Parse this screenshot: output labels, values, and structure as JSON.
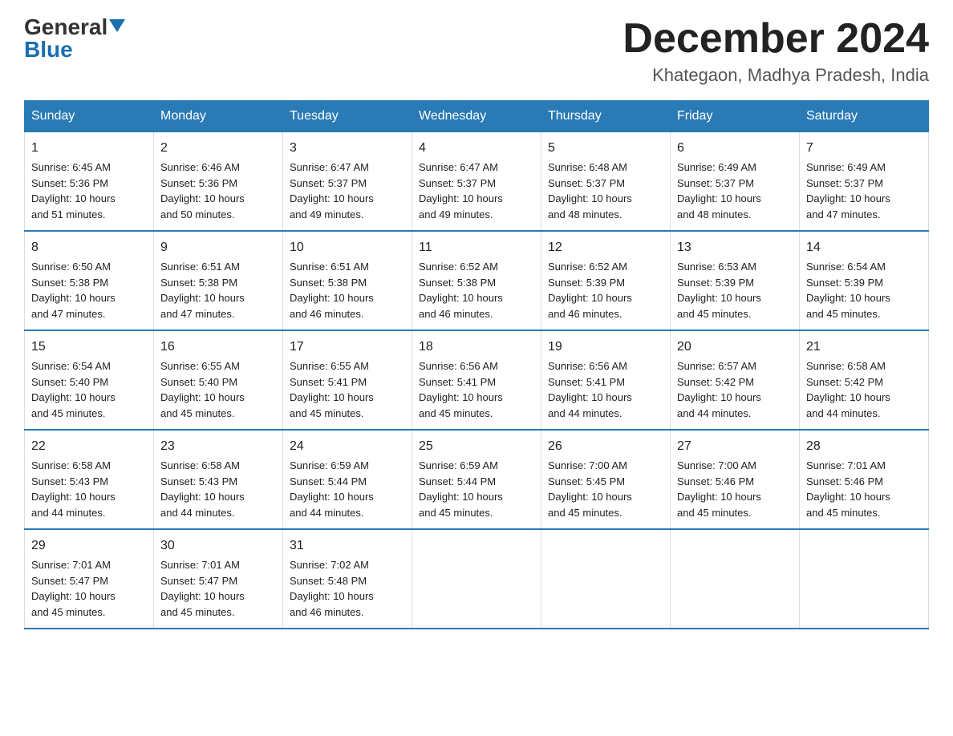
{
  "header": {
    "logo_general": "General",
    "logo_blue": "Blue",
    "month_title": "December 2024",
    "location": "Khategaon, Madhya Pradesh, India"
  },
  "days_of_week": [
    "Sunday",
    "Monday",
    "Tuesday",
    "Wednesday",
    "Thursday",
    "Friday",
    "Saturday"
  ],
  "weeks": [
    [
      {
        "day": "1",
        "sunrise": "6:45 AM",
        "sunset": "5:36 PM",
        "daylight": "10 hours and 51 minutes."
      },
      {
        "day": "2",
        "sunrise": "6:46 AM",
        "sunset": "5:36 PM",
        "daylight": "10 hours and 50 minutes."
      },
      {
        "day": "3",
        "sunrise": "6:47 AM",
        "sunset": "5:37 PM",
        "daylight": "10 hours and 49 minutes."
      },
      {
        "day": "4",
        "sunrise": "6:47 AM",
        "sunset": "5:37 PM",
        "daylight": "10 hours and 49 minutes."
      },
      {
        "day": "5",
        "sunrise": "6:48 AM",
        "sunset": "5:37 PM",
        "daylight": "10 hours and 48 minutes."
      },
      {
        "day": "6",
        "sunrise": "6:49 AM",
        "sunset": "5:37 PM",
        "daylight": "10 hours and 48 minutes."
      },
      {
        "day": "7",
        "sunrise": "6:49 AM",
        "sunset": "5:37 PM",
        "daylight": "10 hours and 47 minutes."
      }
    ],
    [
      {
        "day": "8",
        "sunrise": "6:50 AM",
        "sunset": "5:38 PM",
        "daylight": "10 hours and 47 minutes."
      },
      {
        "day": "9",
        "sunrise": "6:51 AM",
        "sunset": "5:38 PM",
        "daylight": "10 hours and 47 minutes."
      },
      {
        "day": "10",
        "sunrise": "6:51 AM",
        "sunset": "5:38 PM",
        "daylight": "10 hours and 46 minutes."
      },
      {
        "day": "11",
        "sunrise": "6:52 AM",
        "sunset": "5:38 PM",
        "daylight": "10 hours and 46 minutes."
      },
      {
        "day": "12",
        "sunrise": "6:52 AM",
        "sunset": "5:39 PM",
        "daylight": "10 hours and 46 minutes."
      },
      {
        "day": "13",
        "sunrise": "6:53 AM",
        "sunset": "5:39 PM",
        "daylight": "10 hours and 45 minutes."
      },
      {
        "day": "14",
        "sunrise": "6:54 AM",
        "sunset": "5:39 PM",
        "daylight": "10 hours and 45 minutes."
      }
    ],
    [
      {
        "day": "15",
        "sunrise": "6:54 AM",
        "sunset": "5:40 PM",
        "daylight": "10 hours and 45 minutes."
      },
      {
        "day": "16",
        "sunrise": "6:55 AM",
        "sunset": "5:40 PM",
        "daylight": "10 hours and 45 minutes."
      },
      {
        "day": "17",
        "sunrise": "6:55 AM",
        "sunset": "5:41 PM",
        "daylight": "10 hours and 45 minutes."
      },
      {
        "day": "18",
        "sunrise": "6:56 AM",
        "sunset": "5:41 PM",
        "daylight": "10 hours and 45 minutes."
      },
      {
        "day": "19",
        "sunrise": "6:56 AM",
        "sunset": "5:41 PM",
        "daylight": "10 hours and 44 minutes."
      },
      {
        "day": "20",
        "sunrise": "6:57 AM",
        "sunset": "5:42 PM",
        "daylight": "10 hours and 44 minutes."
      },
      {
        "day": "21",
        "sunrise": "6:58 AM",
        "sunset": "5:42 PM",
        "daylight": "10 hours and 44 minutes."
      }
    ],
    [
      {
        "day": "22",
        "sunrise": "6:58 AM",
        "sunset": "5:43 PM",
        "daylight": "10 hours and 44 minutes."
      },
      {
        "day": "23",
        "sunrise": "6:58 AM",
        "sunset": "5:43 PM",
        "daylight": "10 hours and 44 minutes."
      },
      {
        "day": "24",
        "sunrise": "6:59 AM",
        "sunset": "5:44 PM",
        "daylight": "10 hours and 44 minutes."
      },
      {
        "day": "25",
        "sunrise": "6:59 AM",
        "sunset": "5:44 PM",
        "daylight": "10 hours and 45 minutes."
      },
      {
        "day": "26",
        "sunrise": "7:00 AM",
        "sunset": "5:45 PM",
        "daylight": "10 hours and 45 minutes."
      },
      {
        "day": "27",
        "sunrise": "7:00 AM",
        "sunset": "5:46 PM",
        "daylight": "10 hours and 45 minutes."
      },
      {
        "day": "28",
        "sunrise": "7:01 AM",
        "sunset": "5:46 PM",
        "daylight": "10 hours and 45 minutes."
      }
    ],
    [
      {
        "day": "29",
        "sunrise": "7:01 AM",
        "sunset": "5:47 PM",
        "daylight": "10 hours and 45 minutes."
      },
      {
        "day": "30",
        "sunrise": "7:01 AM",
        "sunset": "5:47 PM",
        "daylight": "10 hours and 45 minutes."
      },
      {
        "day": "31",
        "sunrise": "7:02 AM",
        "sunset": "5:48 PM",
        "daylight": "10 hours and 46 minutes."
      },
      null,
      null,
      null,
      null
    ]
  ],
  "labels": {
    "sunrise": "Sunrise:",
    "sunset": "Sunset:",
    "daylight": "Daylight:"
  }
}
